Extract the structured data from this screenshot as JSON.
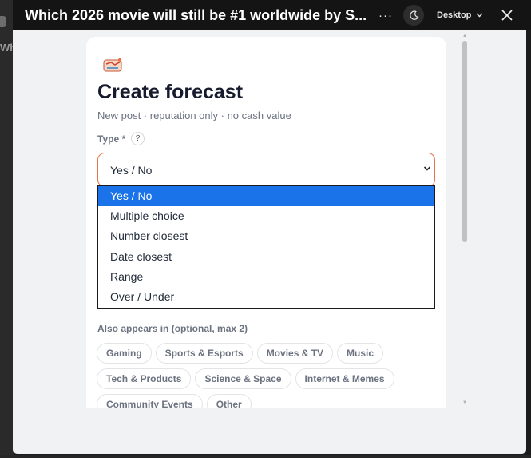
{
  "background": {
    "peek_text": "Whi"
  },
  "titlebar": {
    "title": "Which 2026 movie will still be #1 worldwide by S...",
    "more": "···",
    "device": "Desktop"
  },
  "modal": {
    "heading": "Create forecast",
    "subtitle": "New post · reputation only · no cash value",
    "type_label": "Type *",
    "help": "?",
    "select_value": "Yes / No",
    "options": [
      "Yes / No",
      "Multiple choice",
      "Number closest",
      "Date closest",
      "Range",
      "Over / Under"
    ],
    "also_label": "Also appears in (optional, max 2)",
    "chips": [
      "Gaming",
      "Sports & Esports",
      "Movies & TV",
      "Music",
      "Tech & Products",
      "Science & Space",
      "Internet & Memes",
      "Community Events",
      "Other"
    ]
  },
  "colors": {
    "accent_border": "#e8734a",
    "selected_option": "#1a73e8",
    "titlebar": "#141414"
  }
}
